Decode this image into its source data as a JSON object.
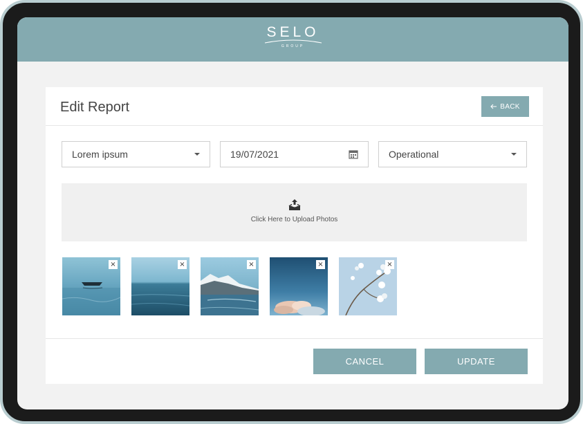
{
  "brand": {
    "name": "SELO",
    "sub": "GROUP"
  },
  "page": {
    "title": "Edit Report",
    "back_label": "BACK"
  },
  "form": {
    "category": {
      "value": "Lorem ipsum"
    },
    "date": {
      "value": "19/07/2021"
    },
    "status": {
      "value": "Operational"
    }
  },
  "upload": {
    "label": "Click Here to Upload Photos"
  },
  "photos": [
    {
      "remove_label": "×"
    },
    {
      "remove_label": "×"
    },
    {
      "remove_label": "×"
    },
    {
      "remove_label": "×"
    },
    {
      "remove_label": "×"
    }
  ],
  "actions": {
    "cancel_label": "CANCEL",
    "update_label": "UPDATE"
  },
  "colors": {
    "accent": "#84aab0",
    "background": "#f2f2f2",
    "frame": "#1b1b1b"
  }
}
